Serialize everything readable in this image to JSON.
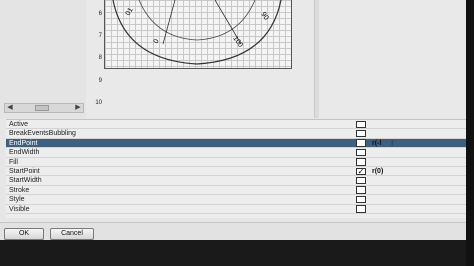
{
  "ruler_ticks": [
    "6",
    "7",
    "8",
    "9",
    "10"
  ],
  "arc_labels": [
    "0",
    "01",
    "90",
    "100"
  ],
  "properties": [
    {
      "name": "Active",
      "checked": false,
      "value": ""
    },
    {
      "name": "BreakEventsBubbling",
      "checked": false,
      "value": ""
    },
    {
      "name": "EndPoint",
      "checked": false,
      "value": "r(-l",
      "selected": true
    },
    {
      "name": "EndWidth",
      "checked": false,
      "value": ""
    },
    {
      "name": "Fill",
      "checked": false,
      "value": ""
    },
    {
      "name": "StartPoint",
      "checked": true,
      "value": "r(0)"
    },
    {
      "name": "StartWidth",
      "checked": false,
      "value": ""
    },
    {
      "name": "Stroke",
      "checked": false,
      "value": ""
    },
    {
      "name": "Style",
      "checked": false,
      "value": ""
    },
    {
      "name": "Visible",
      "checked": false,
      "value": ""
    }
  ],
  "buttons": {
    "ok": "OK",
    "cancel": "Cancel"
  },
  "checkmark_glyph": "✓",
  "colors": {
    "selection": "#3f5f7f",
    "grid_line": "#c8c8c8"
  }
}
